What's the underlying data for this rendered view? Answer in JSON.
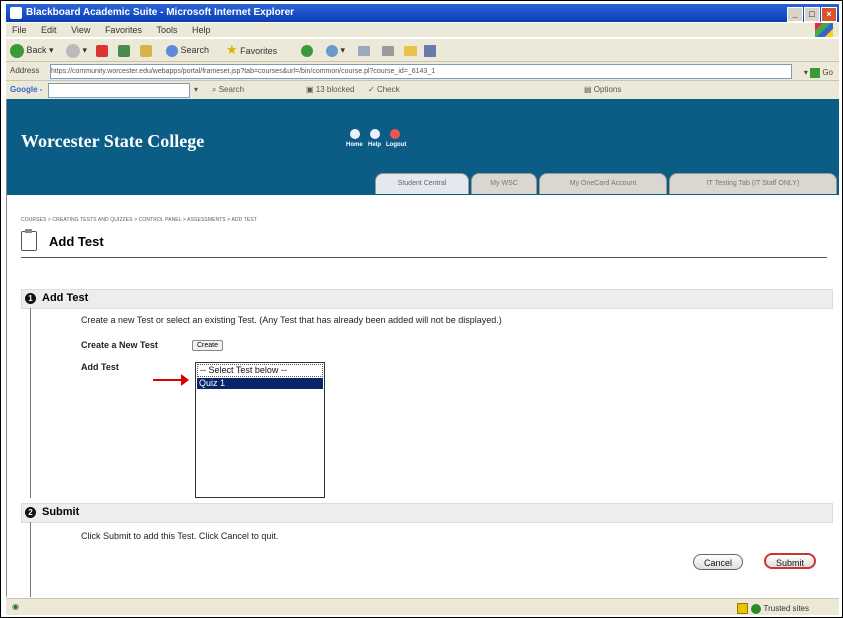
{
  "window": {
    "title": "Blackboard Academic Suite - Microsoft Internet Explorer",
    "controls": [
      "_",
      "□",
      "×"
    ]
  },
  "menu": [
    "File",
    "Edit",
    "View",
    "Favorites",
    "Tools",
    "Help"
  ],
  "toolbar": {
    "back": "Back",
    "search": "Search",
    "favorites": "Favorites"
  },
  "address": {
    "label": "Address",
    "url": "https://community.worcester.edu/webapps/portal/frameset.jsp?tab=courses&url=/bin/common/course.pl?course_id=_6143_1",
    "go": "Go"
  },
  "googlebar": {
    "logo": "Google -",
    "search": "Search",
    "blocked": "13 blocked",
    "check": "Check",
    "options": "Options"
  },
  "banner": {
    "college": "Worcester State College",
    "nav": [
      "Home",
      "Help",
      "Logout"
    ]
  },
  "tabs": [
    "Student Central",
    "My WSC",
    "My OneCard Account",
    "IT Testing Tab (IT Staff ONLY)"
  ],
  "breadcrumb": "COURSES > CREATING TESTS AND QUIZZES > CONTROL PANEL > ASSESSMENTS > ADD TEST",
  "page": {
    "title": "Add Test"
  },
  "section1": {
    "number": "1",
    "title": "Add Test",
    "instructions": "Create a new Test or select an existing Test. (Any Test that has already been added will not be displayed.)",
    "create_label": "Create a New Test",
    "create_button": "Create",
    "add_label": "Add Test",
    "options": [
      "-- Select Test below --",
      "Quiz 1"
    ],
    "selected": "Quiz 1"
  },
  "section2": {
    "number": "2",
    "title": "Submit",
    "instructions": "Click Submit to add this Test. Click Cancel to quit.",
    "cancel": "Cancel",
    "submit": "Submit"
  },
  "status": {
    "zone": "Trusted sites"
  },
  "colors": {
    "banner": "#0b5d86",
    "selection": "#0a246a",
    "arrow": "#dd0000"
  }
}
